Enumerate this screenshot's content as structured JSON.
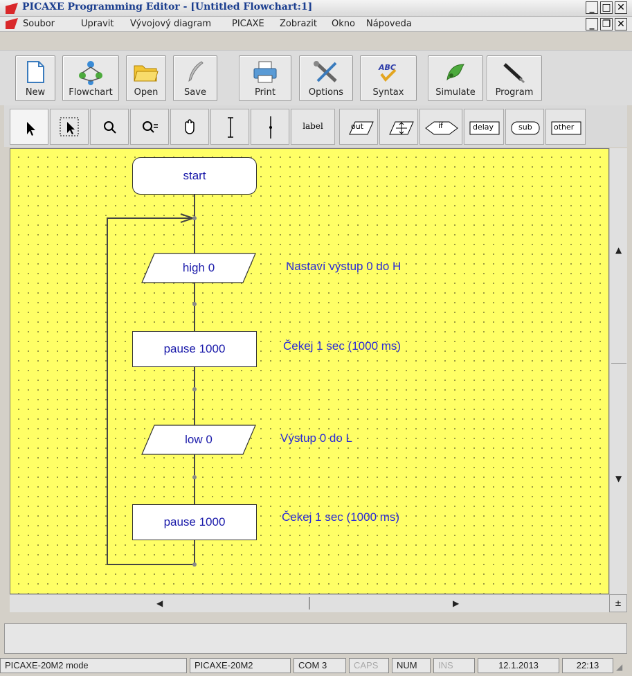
{
  "window": {
    "title": "PICAXE Programming Editor - [Untitled Flowchart:1]"
  },
  "menu": [
    "Soubor",
    "Upravit",
    "Vývojový diagram",
    "PICAXE",
    "Zobrazit",
    "Okno",
    "Nápoveda"
  ],
  "toolbar": {
    "new": "New",
    "flowchart": "Flowchart",
    "open": "Open",
    "save": "Save",
    "print": "Print",
    "options": "Options",
    "syntax": "Syntax",
    "simulate": "Simulate",
    "program": "Program",
    "syntax_icon_text": "ABC"
  },
  "palette": {
    "label": "label",
    "out": "out",
    "if": "if",
    "delay": "delay",
    "sub": "sub",
    "other": "other"
  },
  "flowchart": {
    "start": "start",
    "n1": "high 0",
    "n2": "pause 1000",
    "n3": "low 0",
    "n4": "pause 1000",
    "c1": "Nastaví výstup 0 do H",
    "c2": "Čekej 1 sec (1000 ms)",
    "c3": "Výstup 0 do L",
    "c4": "Čekej 1 sec (1000 ms)"
  },
  "statusbar": {
    "mode": "PICAXE-20M2 mode",
    "chip": "PICAXE-20M2",
    "port": "COM 3",
    "caps": "CAPS",
    "num": "NUM",
    "ins": "INS",
    "date": "12.1.2013",
    "time": "22:13"
  },
  "colors": {
    "canvas": "#ffff66",
    "text_blue": "#2a2ad8",
    "title_blue": "#1b3e8f"
  }
}
